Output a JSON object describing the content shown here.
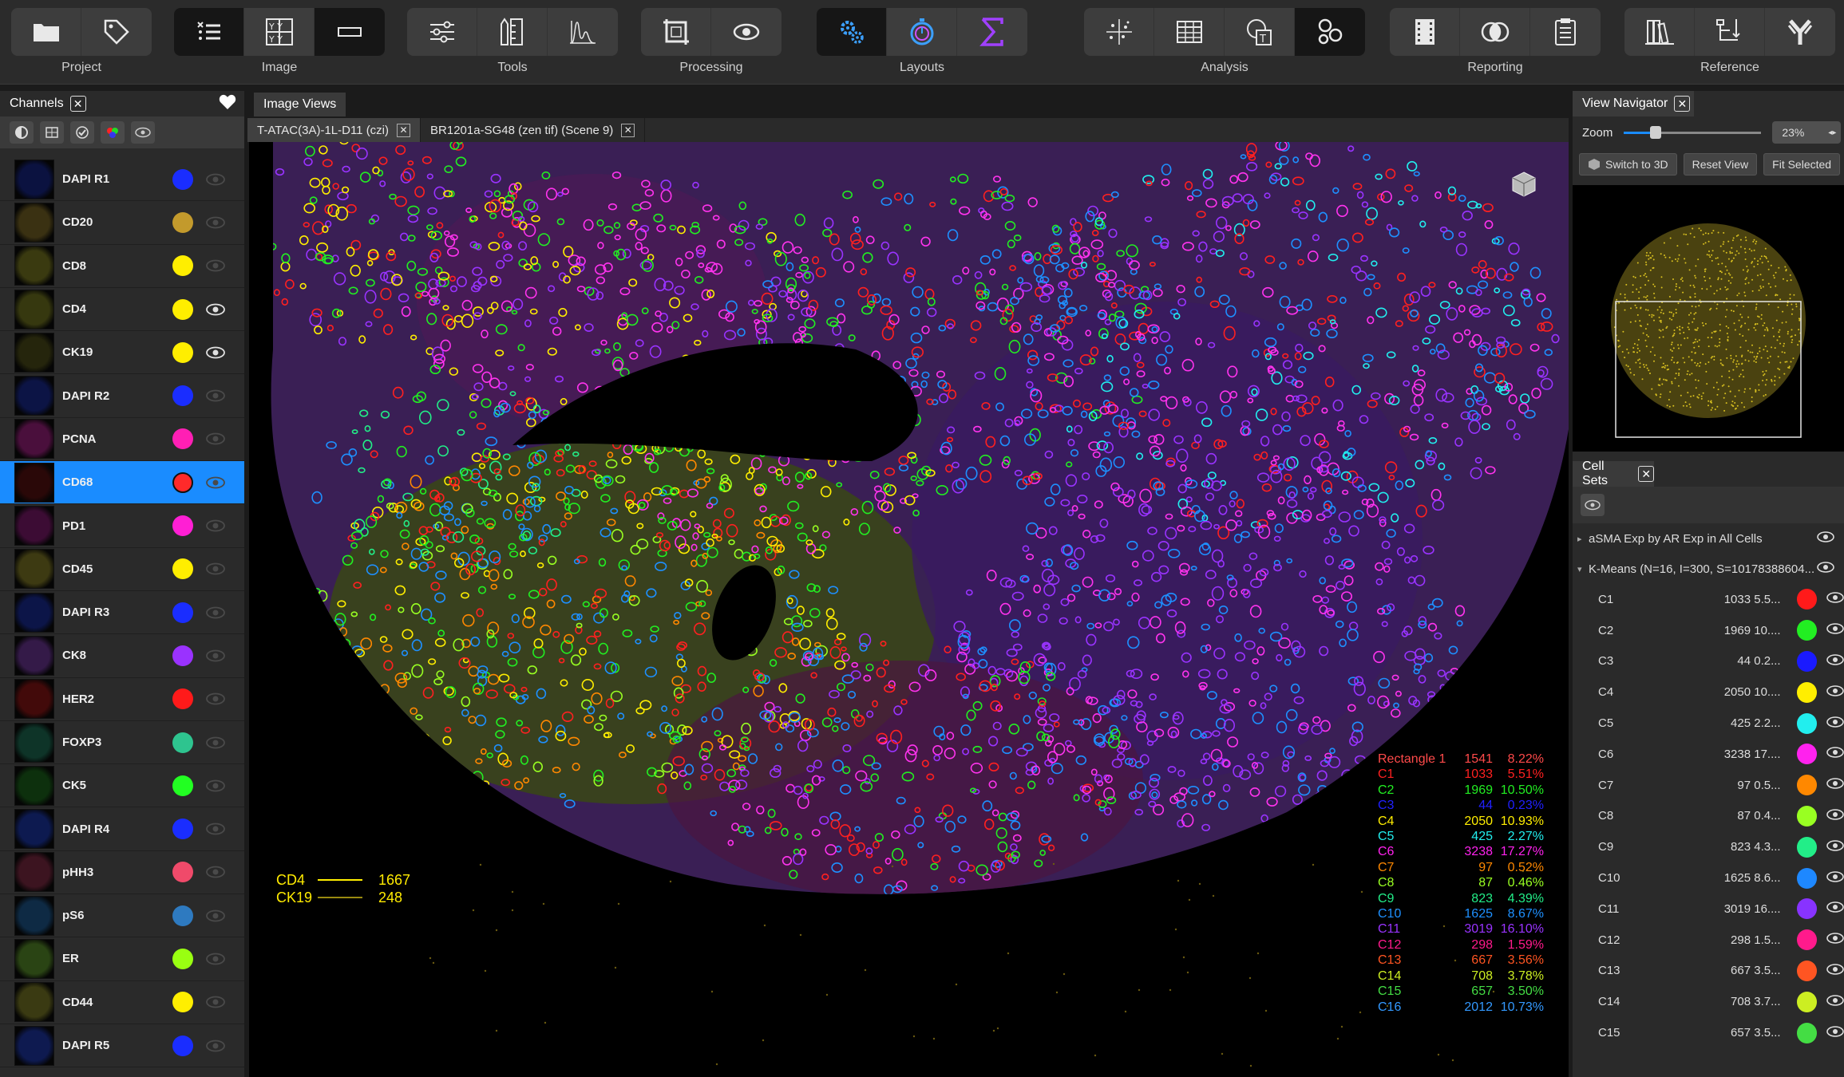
{
  "toolbar": {
    "groups": [
      {
        "label": "Project",
        "buttons": [
          {
            "icon": "folder-icon"
          },
          {
            "icon": "tag-icon"
          }
        ]
      },
      {
        "label": "Image",
        "buttons": [
          {
            "icon": "channel-list-icon"
          },
          {
            "icon": "grid-letters-icon"
          },
          {
            "icon": "rectangle-icon"
          }
        ]
      },
      {
        "label": "Tools",
        "buttons": [
          {
            "icon": "sliders-icon"
          },
          {
            "icon": "ruler-pencil-icon"
          },
          {
            "icon": "histogram-icon"
          }
        ]
      },
      {
        "label": "Processing",
        "buttons": [
          {
            "icon": "crop-icon"
          },
          {
            "icon": "eye-icon"
          }
        ]
      },
      {
        "label": "Layouts",
        "buttons": [
          {
            "icon": "gears-icon"
          },
          {
            "icon": "stopwatch-icon"
          },
          {
            "icon": "sigma-icon"
          }
        ]
      },
      {
        "label": "Analysis",
        "buttons": [
          {
            "icon": "scatter-icon"
          },
          {
            "icon": "table-icon"
          },
          {
            "icon": "shape-text-icon"
          },
          {
            "icon": "circles-icon"
          }
        ]
      },
      {
        "label": "Reporting",
        "buttons": [
          {
            "icon": "film-icon"
          },
          {
            "icon": "venn-icon"
          },
          {
            "icon": "clipboard-icon"
          }
        ]
      },
      {
        "label": "Reference",
        "buttons": [
          {
            "icon": "books-icon"
          },
          {
            "icon": "tree-icon"
          },
          {
            "icon": "antibody-icon"
          }
        ]
      }
    ]
  },
  "channels_panel": {
    "title": "Channels",
    "close": "✕",
    "items": [
      {
        "name": "DAPI R1",
        "color": "#1a2dff",
        "thumb": "#0b1240",
        "eye_visible": false,
        "selected": false
      },
      {
        "name": "CD20",
        "color": "#c39a2c",
        "thumb": "#3a3112",
        "eye_visible": false,
        "selected": false
      },
      {
        "name": "CD8",
        "color": "#ffee00",
        "thumb": "#3a3a10",
        "eye_visible": false,
        "selected": false
      },
      {
        "name": "CD4",
        "color": "#ffee00",
        "thumb": "#36380f",
        "eye_visible": true,
        "selected": false
      },
      {
        "name": "CK19",
        "color": "#ffee00",
        "thumb": "#25250c",
        "eye_visible": true,
        "selected": false
      },
      {
        "name": "DAPI R2",
        "color": "#1a2dff",
        "thumb": "#0c1445",
        "eye_visible": false,
        "selected": false
      },
      {
        "name": "PCNA",
        "color": "#ff1fb4",
        "thumb": "#4a0f3c",
        "eye_visible": false,
        "selected": false
      },
      {
        "name": "CD68",
        "color": "#ff2a2a",
        "thumb": "#2a0808",
        "eye_visible": false,
        "selected": true
      },
      {
        "name": "PD1",
        "color": "#ff1fd4",
        "thumb": "#3c0c34",
        "eye_visible": false,
        "selected": false
      },
      {
        "name": "CD45",
        "color": "#ffee00",
        "thumb": "#3d3a12",
        "eye_visible": false,
        "selected": false
      },
      {
        "name": "DAPI R3",
        "color": "#1a2dff",
        "thumb": "#0c1548",
        "eye_visible": false,
        "selected": false
      },
      {
        "name": "CK8",
        "color": "#9a32ff",
        "thumb": "#341a48",
        "eye_visible": false,
        "selected": false
      },
      {
        "name": "HER2",
        "color": "#ff1a1a",
        "thumb": "#420a0a",
        "eye_visible": false,
        "selected": false
      },
      {
        "name": "FOXP3",
        "color": "#2ec48f",
        "thumb": "#0e3428",
        "eye_visible": false,
        "selected": false
      },
      {
        "name": "CK5",
        "color": "#22ff22",
        "thumb": "#0d300d",
        "eye_visible": false,
        "selected": false
      },
      {
        "name": "DAPI R4",
        "color": "#1a2dff",
        "thumb": "#0d1a50",
        "eye_visible": false,
        "selected": false
      },
      {
        "name": "pHH3",
        "color": "#f04a6a",
        "thumb": "#3c1420",
        "eye_visible": false,
        "selected": false
      },
      {
        "name": "pS6",
        "color": "#2e7ac0",
        "thumb": "#0e2a44",
        "eye_visible": false,
        "selected": false
      },
      {
        "name": "ER",
        "color": "#99ff11",
        "thumb": "#2a4414",
        "eye_visible": false,
        "selected": false
      },
      {
        "name": "CD44",
        "color": "#ffee00",
        "thumb": "#3a3a12",
        "eye_visible": false,
        "selected": false
      },
      {
        "name": "DAPI R5",
        "color": "#1a2dff",
        "thumb": "#0e1a50",
        "eye_visible": false,
        "selected": false
      }
    ]
  },
  "image_views": {
    "title": "Image Views",
    "tabs": [
      {
        "label": "T-ATAC(3A)-1L-D11 (czi)",
        "active": true,
        "close": "✕"
      },
      {
        "label": "BR1201a-SG48 (zen tif) (Scene 9)",
        "active": false,
        "close": "✕"
      }
    ]
  },
  "overlay_legend": [
    {
      "name": "CD4",
      "value": "1667"
    },
    {
      "name": "CK19",
      "value": "248"
    }
  ],
  "region_stats": {
    "header": {
      "name": "Rectangle 1",
      "count": "1541",
      "pct": "8.22%",
      "color": "#ff4a4a"
    },
    "rows": [
      {
        "name": "C1",
        "count": "1033",
        "pct": "5.51%",
        "color": "#ff2020"
      },
      {
        "name": "C2",
        "count": "1969",
        "pct": "10.50%",
        "color": "#22ee22"
      },
      {
        "name": "C3",
        "count": "44",
        "pct": "0.23%",
        "color": "#2020ff"
      },
      {
        "name": "C4",
        "count": "2050",
        "pct": "10.93%",
        "color": "#ffee00"
      },
      {
        "name": "C5",
        "count": "425",
        "pct": "2.27%",
        "color": "#22eeee"
      },
      {
        "name": "C6",
        "count": "3238",
        "pct": "17.27%",
        "color": "#ff22ee"
      },
      {
        "name": "C7",
        "count": "97",
        "pct": "0.52%",
        "color": "#ff8800"
      },
      {
        "name": "C8",
        "count": "87",
        "pct": "0.46%",
        "color": "#99ff22"
      },
      {
        "name": "C9",
        "count": "823",
        "pct": "4.39%",
        "color": "#22ee88"
      },
      {
        "name": "C10",
        "count": "1625",
        "pct": "8.67%",
        "color": "#1e90ff"
      },
      {
        "name": "C11",
        "count": "3019",
        "pct": "16.10%",
        "color": "#9933ff"
      },
      {
        "name": "C12",
        "count": "298",
        "pct": "1.59%",
        "color": "#ff1a8c"
      },
      {
        "name": "C13",
        "count": "667",
        "pct": "3.56%",
        "color": "#ff5522"
      },
      {
        "name": "C14",
        "count": "708",
        "pct": "3.78%",
        "color": "#ccee22"
      },
      {
        "name": "C15",
        "count": "657",
        "pct": "3.50%",
        "color": "#44dd44"
      },
      {
        "name": "C16",
        "count": "2012",
        "pct": "10.73%",
        "color": "#3399ff"
      }
    ]
  },
  "view_navigator": {
    "title": "View Navigator",
    "close": "✕",
    "zoom_label": "Zoom",
    "zoom_value": "23%",
    "zoom_fraction": 0.23,
    "buttons": [
      "Switch to 3D",
      "Reset View",
      "Fit Selected"
    ]
  },
  "cell_sets": {
    "title": "Cell Sets",
    "close": "✕",
    "groups": [
      {
        "label": "aSMA Exp by AR Exp in All Cells",
        "expanded": false
      },
      {
        "label": "K-Means (N=16, I=300, S=10178388604...",
        "expanded": true
      }
    ],
    "items": [
      {
        "name": "C1",
        "value": "1033 5.5...",
        "color": "#ff1a1a"
      },
      {
        "name": "C2",
        "value": "1969 10....",
        "color": "#22ee22"
      },
      {
        "name": "C3",
        "value": "44 0.2...",
        "color": "#1a1aff"
      },
      {
        "name": "C4",
        "value": "2050 10....",
        "color": "#ffee00"
      },
      {
        "name": "C5",
        "value": "425 2.2...",
        "color": "#22eeee"
      },
      {
        "name": "C6",
        "value": "3238 17....",
        "color": "#ff22ee"
      },
      {
        "name": "C7",
        "value": "97 0.5...",
        "color": "#ff8800"
      },
      {
        "name": "C8",
        "value": "87 0.4...",
        "color": "#99ff22"
      },
      {
        "name": "C9",
        "value": "823 4.3...",
        "color": "#22ee88"
      },
      {
        "name": "C10",
        "value": "1625 8.6...",
        "color": "#1e88ff"
      },
      {
        "name": "C11",
        "value": "3019 16....",
        "color": "#8833ff"
      },
      {
        "name": "C12",
        "value": "298 1.5...",
        "color": "#ff1a8c"
      },
      {
        "name": "C13",
        "value": "667 3.5...",
        "color": "#ff5522"
      },
      {
        "name": "C14",
        "value": "708 3.7...",
        "color": "#ccee22"
      },
      {
        "name": "C15",
        "value": "657 3.5...",
        "color": "#44dd44"
      }
    ]
  }
}
